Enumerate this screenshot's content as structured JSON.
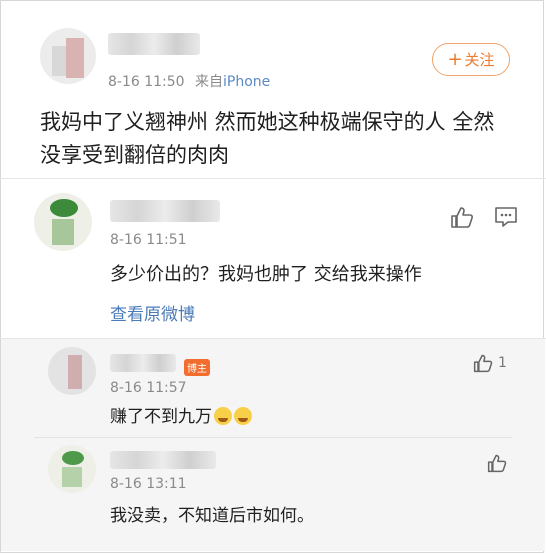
{
  "post": {
    "time": "8-16 11:50",
    "source_prefix": "来自",
    "source": "iPhone",
    "follow_plus": "+",
    "follow_label": "关注",
    "text_line1": "我妈中了义翘神州 然而她这种极端保守的人 全然",
    "text_line2": "没享受到翻倍的肉肉"
  },
  "comment": {
    "time": "8-16 11:51",
    "text": "多少价出的？我妈也肿了 交给我来操作",
    "view_original": "查看原微博"
  },
  "replies": [
    {
      "time": "8-16 11:57",
      "badge": "博主",
      "text": "赚了不到九万",
      "like_count": "1"
    },
    {
      "time": "8-16 13:11",
      "text": "我没卖，不知道后市如何。"
    }
  ],
  "icons": {
    "like": "thumbs-up-icon",
    "comment": "comment-icon",
    "emoji": "crying-emoji-icon"
  }
}
